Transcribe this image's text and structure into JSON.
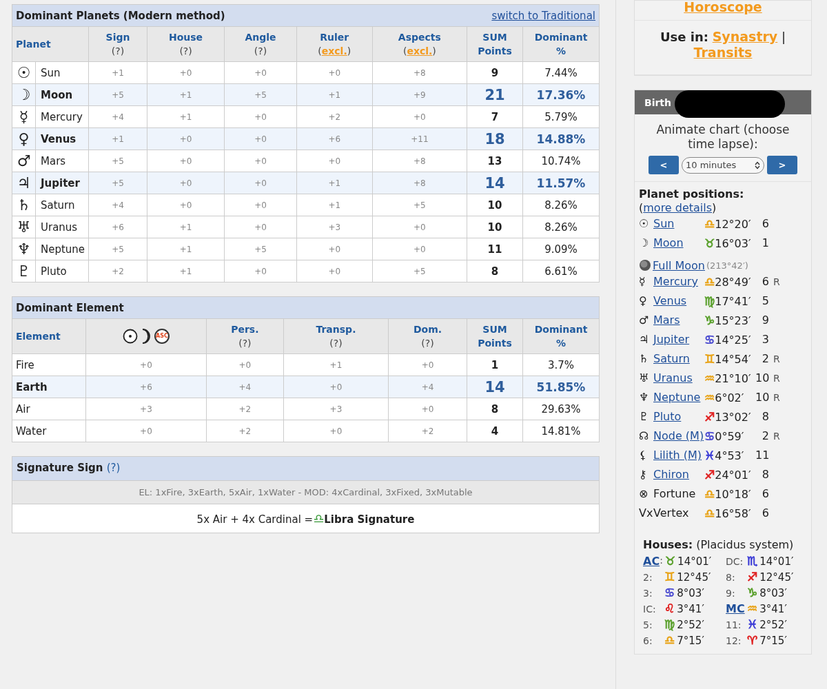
{
  "dominant_planets": {
    "title": "Dominant Planets (Modern method)",
    "switch_link": "switch to Traditional",
    "columns": [
      {
        "label": "Planet"
      },
      {
        "label": "Sign",
        "sub": {
          "text": "(?)"
        }
      },
      {
        "label": "House",
        "sub": {
          "text": "(?)"
        }
      },
      {
        "label": "Angle",
        "sub": {
          "text": "(?)"
        }
      },
      {
        "label": "Ruler",
        "sub": {
          "before": "(",
          "link": "excl.",
          "after": ")"
        }
      },
      {
        "label": "Aspects",
        "sub": {
          "before": "(",
          "link": "excl.",
          "after": ")"
        }
      },
      {
        "label": "SUM",
        "label2": "Points"
      },
      {
        "label": "Dominant",
        "label2": "%"
      }
    ],
    "rows": [
      {
        "symbol": "☉",
        "dominant": false,
        "cells": [
          "Sun",
          "+1",
          "+0",
          "+0",
          "+0",
          "+8",
          "9",
          "7.44%"
        ]
      },
      {
        "symbol": "☽",
        "dominant": true,
        "cells": [
          "Moon",
          "+5",
          "+1",
          "+5",
          "+1",
          "+9",
          "21",
          "17.36%"
        ]
      },
      {
        "symbol": "☿",
        "dominant": false,
        "cells": [
          "Mercury",
          "+4",
          "+1",
          "+0",
          "+2",
          "+0",
          "7",
          "5.79%"
        ]
      },
      {
        "symbol": "♀",
        "dominant": true,
        "cells": [
          "Venus",
          "+1",
          "+0",
          "+0",
          "+6",
          "+11",
          "18",
          "14.88%"
        ]
      },
      {
        "symbol": "♂",
        "dominant": false,
        "cells": [
          "Mars",
          "+5",
          "+0",
          "+0",
          "+0",
          "+8",
          "13",
          "10.74%"
        ]
      },
      {
        "symbol": "♃",
        "dominant": true,
        "cells": [
          "Jupiter",
          "+5",
          "+0",
          "+0",
          "+1",
          "+8",
          "14",
          "11.57%"
        ]
      },
      {
        "symbol": "♄",
        "dominant": false,
        "cells": [
          "Saturn",
          "+4",
          "+0",
          "+0",
          "+1",
          "+5",
          "10",
          "8.26%"
        ]
      },
      {
        "symbol": "♅",
        "dominant": false,
        "cells": [
          "Uranus",
          "+6",
          "+1",
          "+0",
          "+3",
          "+0",
          "10",
          "8.26%"
        ]
      },
      {
        "symbol": "♆",
        "dominant": false,
        "cells": [
          "Neptune",
          "+5",
          "+1",
          "+5",
          "+0",
          "+0",
          "11",
          "9.09%"
        ]
      },
      {
        "symbol": "♇",
        "dominant": false,
        "cells": [
          "Pluto",
          "+2",
          "+1",
          "+0",
          "+0",
          "+5",
          "8",
          "6.61%"
        ]
      }
    ]
  },
  "dominant_element": {
    "title": "Dominant Element",
    "asc_label": "ASC",
    "columns": [
      {
        "label": "Element"
      },
      {
        "kind": "icons"
      },
      {
        "label": "Pers.",
        "sub": {
          "text": "(?)"
        }
      },
      {
        "label": "Transp.",
        "sub": {
          "text": "(?)"
        }
      },
      {
        "label": "Dom.",
        "sub": {
          "text": "(?)"
        }
      },
      {
        "label": "SUM",
        "label2": "Points"
      },
      {
        "label": "Dominant",
        "label2": "%"
      }
    ],
    "rows": [
      {
        "dominant": false,
        "cells": [
          "Fire",
          "+0",
          "+0",
          "+1",
          "+0",
          "1",
          "3.7%"
        ]
      },
      {
        "dominant": true,
        "cells": [
          "Earth",
          "+6",
          "+4",
          "+0",
          "+4",
          "14",
          "51.85%"
        ]
      },
      {
        "dominant": false,
        "cells": [
          "Air",
          "+3",
          "+2",
          "+3",
          "+0",
          "8",
          "29.63%"
        ]
      },
      {
        "dominant": false,
        "cells": [
          "Water",
          "+0",
          "+2",
          "+0",
          "+2",
          "4",
          "14.81%"
        ]
      }
    ]
  },
  "signature": {
    "title": "Signature Sign",
    "help": "(?)",
    "summary": "EL: 1xFire, 3xEarth, 5xAir, 1xWater -  MOD: 4xCardinal, 3xFixed, 3xMutable",
    "formula": "5x Air + 4x Cardinal =",
    "sign_symbol": "♎",
    "result": "Libra Signature"
  },
  "sidebar": {
    "horoscope_link": "Horoscope",
    "use_in": {
      "label": "Use in:",
      "links": [
        "Synastry",
        "Transits"
      ],
      "separator": "|"
    },
    "birth": {
      "title": "Birth",
      "redacted": true
    },
    "animate": {
      "text": "Animate chart (choose time lapse):",
      "prev": "<",
      "select": "10 minutes",
      "next": ">"
    },
    "positions": {
      "title": "Planet positions:",
      "open": "(",
      "link": "more details",
      "close": ")",
      "rows": [
        {
          "kind": "planet",
          "symbol": "☉",
          "name": "Sun",
          "link": true,
          "sign": "♎",
          "color": "#e8a317",
          "degree": "12°20′",
          "house": "6",
          "retro": ""
        },
        {
          "kind": "planet",
          "symbol": "☽",
          "name": "Moon",
          "link": true,
          "sign": "♉",
          "color": "#5aa02c",
          "degree": "16°03′",
          "house": "1",
          "retro": ""
        },
        {
          "kind": "phase",
          "name": "Full Moon",
          "note": "(213°42′)"
        },
        {
          "kind": "planet",
          "symbol": "☿",
          "name": "Mercury",
          "link": true,
          "sign": "♎",
          "color": "#e8a317",
          "degree": "28°49′",
          "house": "6",
          "retro": "R"
        },
        {
          "kind": "planet",
          "symbol": "♀",
          "name": "Venus",
          "link": true,
          "sign": "♍",
          "color": "#5aa02c",
          "degree": "17°41′",
          "house": "5",
          "retro": ""
        },
        {
          "kind": "planet",
          "symbol": "♂",
          "name": "Mars",
          "link": true,
          "sign": "♑",
          "color": "#5aa02c",
          "degree": "15°23′",
          "house": "9",
          "retro": ""
        },
        {
          "kind": "planet",
          "symbol": "♃",
          "name": "Jupiter",
          "link": true,
          "sign": "♋",
          "color": "#4a4ad0",
          "degree": "14°25′",
          "house": "3",
          "retro": ""
        },
        {
          "kind": "planet",
          "symbol": "♄",
          "name": "Saturn",
          "link": true,
          "sign": "♊",
          "color": "#e8a317",
          "degree": "14°54′",
          "house": "2",
          "retro": "R"
        },
        {
          "kind": "planet",
          "symbol": "♅",
          "name": "Uranus",
          "link": true,
          "sign": "♒",
          "color": "#e8a317",
          "degree": "21°10′",
          "house": "10",
          "retro": "R"
        },
        {
          "kind": "planet",
          "symbol": "♆",
          "name": "Neptune",
          "link": true,
          "sign": "♒",
          "color": "#e8a317",
          "degree": "6°02′",
          "house": "10",
          "retro": "R"
        },
        {
          "kind": "planet",
          "symbol": "♇",
          "name": "Pluto",
          "link": true,
          "sign": "♐",
          "color": "#e02020",
          "degree": "13°02′",
          "house": "8",
          "retro": ""
        },
        {
          "kind": "planet",
          "symbol": "☊",
          "name": "Node (M)",
          "link": true,
          "sign": "♋",
          "color": "#4a4ad0",
          "degree": "0°59′",
          "house": "2",
          "retro": "R"
        },
        {
          "kind": "planet",
          "symbol": "⚸",
          "name": "Lilith (M)",
          "link": true,
          "sign": "♓",
          "color": "#3b3bd6",
          "degree": "4°53′",
          "house": "11",
          "retro": ""
        },
        {
          "kind": "planet",
          "symbol": "⚷",
          "name": "Chiron",
          "link": true,
          "sign": "♐",
          "color": "#e02020",
          "degree": "24°01′",
          "house": "8",
          "retro": ""
        },
        {
          "kind": "planet",
          "symbol": "⊗",
          "name": "Fortune",
          "link": false,
          "sign": "♎",
          "color": "#e8a317",
          "degree": "10°18′",
          "house": "6",
          "retro": ""
        },
        {
          "kind": "planet",
          "symbol": "Vx",
          "name": "Vertex",
          "link": false,
          "sign": "♎",
          "color": "#e8a317",
          "degree": "16°58′",
          "house": "6",
          "retro": ""
        }
      ]
    },
    "houses": {
      "title": "Houses:",
      "system": "(Placidus system)",
      "cells": [
        {
          "label": "AC",
          "link": true,
          "sep": ":",
          "sign": "♉",
          "color": "#5aa02c",
          "degree": "14°01′"
        },
        {
          "label": "DC:",
          "link": false,
          "sign": "♏",
          "color": "#3b3bd6",
          "degree": "14°01′"
        },
        {
          "label": "2:",
          "link": false,
          "sign": "♊",
          "color": "#e8a317",
          "degree": "12°45′"
        },
        {
          "label": "8:",
          "link": false,
          "sign": "♐",
          "color": "#e02020",
          "degree": "12°45′"
        },
        {
          "label": "3:",
          "link": false,
          "sign": "♋",
          "color": "#4a4ad0",
          "degree": "8°03′"
        },
        {
          "label": "9:",
          "link": false,
          "sign": "♑",
          "color": "#5aa02c",
          "degree": "8°03′"
        },
        {
          "label": "IC:",
          "link": false,
          "sign": "♌",
          "color": "#e02020",
          "degree": "3°41′"
        },
        {
          "label": "MC",
          "link": true,
          "sign": "♒",
          "color": "#e8a317",
          "degree": "3°41′"
        },
        {
          "label": "5:",
          "link": false,
          "sign": "♍",
          "color": "#5aa02c",
          "degree": "2°52′"
        },
        {
          "label": "11:",
          "link": false,
          "sign": "♓",
          "color": "#3b3bd6",
          "degree": "2°52′"
        },
        {
          "label": "6:",
          "link": false,
          "sign": "♎",
          "color": "#e8a317",
          "degree": "7°15′"
        },
        {
          "label": "12:",
          "link": false,
          "sign": "♈",
          "color": "#e02020",
          "degree": "7°15′"
        }
      ]
    }
  }
}
